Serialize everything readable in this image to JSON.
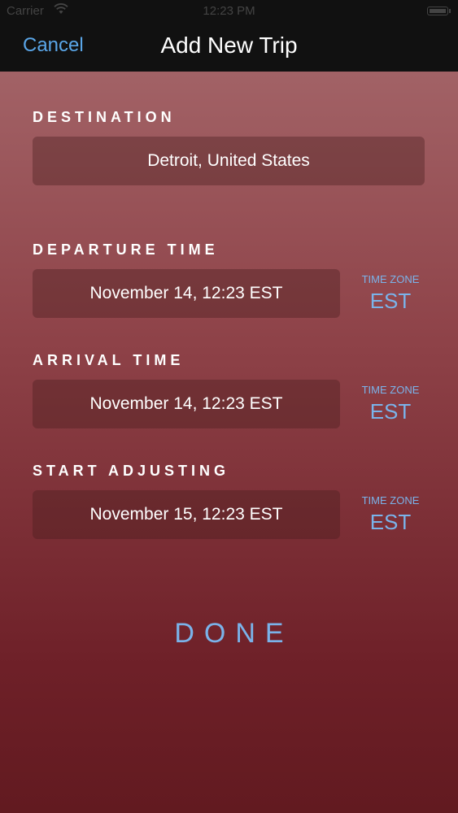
{
  "status_bar": {
    "carrier": "Carrier",
    "time": "12:23 PM"
  },
  "nav": {
    "cancel_label": "Cancel",
    "title": "Add New Trip"
  },
  "destination": {
    "label": "DESTINATION",
    "value": "Detroit, United States"
  },
  "departure": {
    "label": "DEPARTURE TIME",
    "value": "November 14, 12:23 EST",
    "tz_label": "TIME ZONE",
    "tz_value": "EST"
  },
  "arrival": {
    "label": "ARRIVAL TIME",
    "value": "November 14, 12:23 EST",
    "tz_label": "TIME ZONE",
    "tz_value": "EST"
  },
  "start_adjusting": {
    "label": "START ADJUSTING",
    "value": "November 15, 12:23 EST",
    "tz_label": "TIME ZONE",
    "tz_value": "EST"
  },
  "done_label": "DONE",
  "colors": {
    "accent": "#5aa6e8",
    "tz_accent": "#7ab3ea",
    "nav_background": "#111111",
    "background_top": "#a26266",
    "background_bottom": "#621a20"
  },
  "icons": [
    "wifi-icon",
    "battery-icon"
  ]
}
